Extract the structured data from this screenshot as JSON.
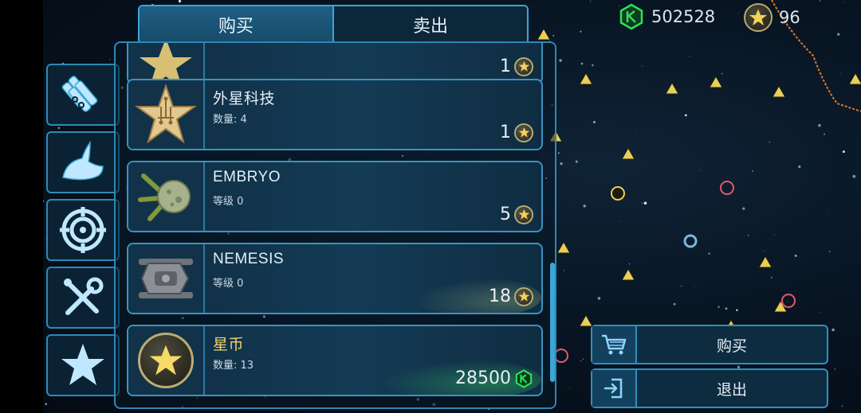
{
  "tabs": {
    "buy": "购买",
    "sell": "卖出"
  },
  "currency": {
    "gems": "502528",
    "stars": "96"
  },
  "side_buttons": [
    "ammo-icon",
    "claw-icon",
    "target-icon",
    "tools-icon",
    "star-icon"
  ],
  "items": [
    {
      "name": "",
      "sub": "",
      "price": "1",
      "currency": "star"
    },
    {
      "name": "外星科技",
      "sub": "数量: 4",
      "price": "1",
      "currency": "star"
    },
    {
      "name": "EMBRYO",
      "sub": "等级 0",
      "price": "5",
      "currency": "star"
    },
    {
      "name": "NEMESIS",
      "sub": "等级 0",
      "price": "18",
      "currency": "star"
    },
    {
      "name": "星币",
      "sub": "数量: 13",
      "price": "28500",
      "currency": "gem"
    }
  ],
  "actions": {
    "buy": "购买",
    "exit": "退出"
  },
  "colors": {
    "accent": "#3aa6d8",
    "gem_green": "#2ee05a",
    "star_gold": "#f3d35a"
  }
}
